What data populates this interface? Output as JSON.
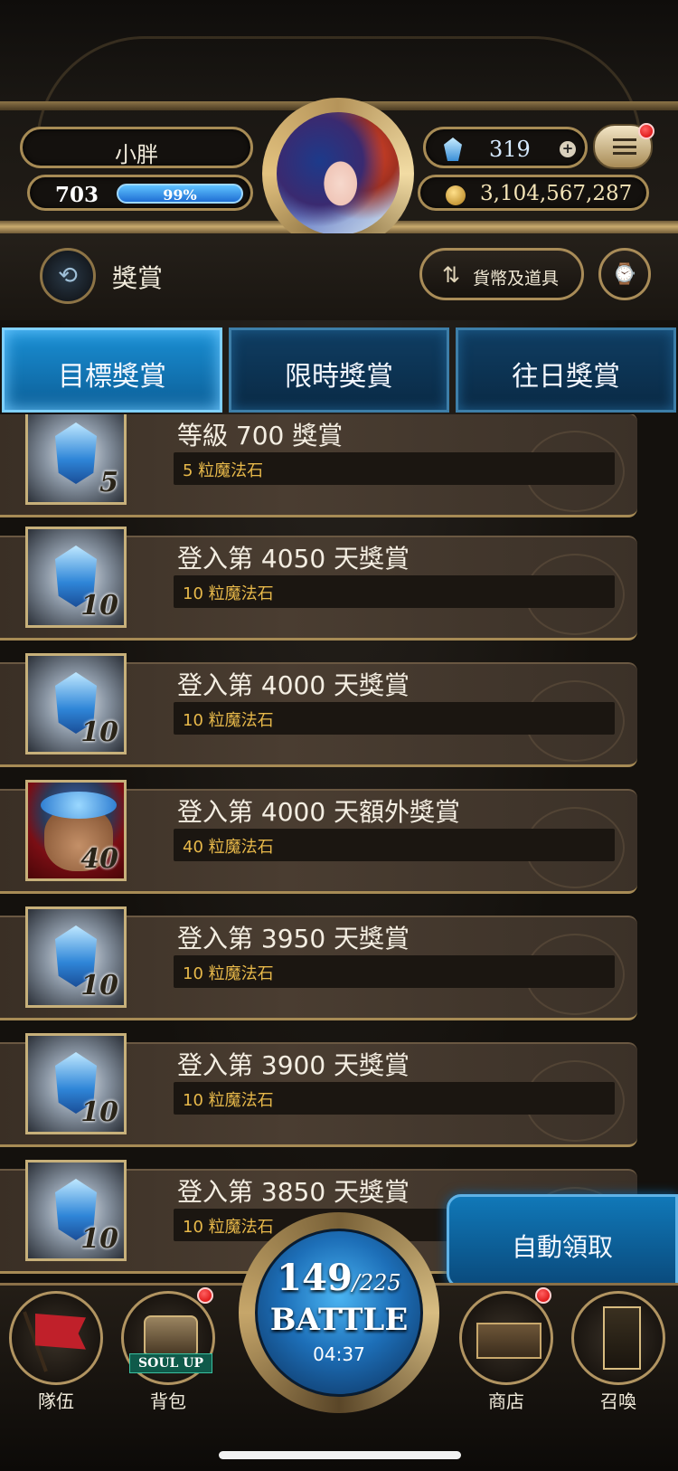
{
  "profile": {
    "name": "小胖",
    "level": "703",
    "exp_percent": "99%",
    "gems": "319",
    "coins": "3,104,567,287"
  },
  "header": {
    "title": "獎賞",
    "currency_button": "貨幣及道具"
  },
  "tabs": [
    {
      "label": "目標獎賞",
      "active": true
    },
    {
      "label": "限時獎賞",
      "active": false
    },
    {
      "label": "往日獎賞",
      "active": false
    }
  ],
  "rewards": [
    {
      "title": "等級 700 獎賞",
      "item": "5 粒魔法石",
      "qty": "5",
      "icon": "magic-stone-icon"
    },
    {
      "title": "登入第 4050 天獎賞",
      "item": "10 粒魔法石",
      "qty": "10",
      "icon": "magic-stone-icon"
    },
    {
      "title": "登入第 4000 天獎賞",
      "item": "10 粒魔法石",
      "qty": "10",
      "icon": "magic-stone-icon"
    },
    {
      "title": "登入第 4000 天額外獎賞",
      "item": "40 粒魔法石",
      "qty": "40",
      "icon": "stone-bag-icon"
    },
    {
      "title": "登入第 3950 天獎賞",
      "item": "10 粒魔法石",
      "qty": "10",
      "icon": "magic-stone-icon"
    },
    {
      "title": "登入第 3900 天獎賞",
      "item": "10 粒魔法石",
      "qty": "10",
      "icon": "magic-stone-icon"
    },
    {
      "title": "登入第 3850 天獎賞",
      "item": "10 粒魔法石",
      "qty": "10",
      "icon": "magic-stone-icon"
    }
  ],
  "auto_claim": "自動領取",
  "battle": {
    "stamina_current": "149",
    "stamina_max": "/225",
    "label": "BATTLE",
    "timer": "04:37"
  },
  "nav": {
    "team": "隊伍",
    "bag": "背包",
    "soul_up": "SOUL UP",
    "shop": "商店",
    "summon": "召喚"
  }
}
